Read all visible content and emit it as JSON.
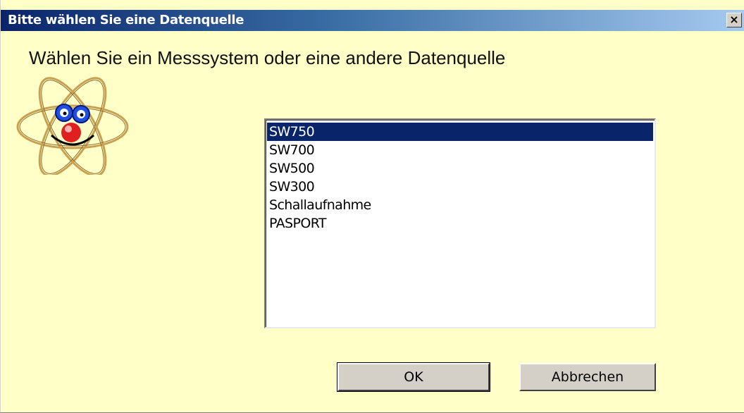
{
  "window": {
    "title": "Bitte wählen Sie eine Datenquelle",
    "close_label": "×"
  },
  "dialog": {
    "heading": "Wählen Sie ein Messsystem oder eine andere Datenquelle",
    "mascot_icon": "atom-mascot-icon",
    "list": {
      "items": [
        "SW750",
        "SW700",
        "SW500",
        "SW300",
        "Schallaufnahme",
        "PASPORT"
      ],
      "selected": "SW750"
    },
    "ok_label": "OK",
    "cancel_label": "Abbrechen"
  },
  "colors": {
    "background": "#ffffc8",
    "selection": "#0a246a",
    "title_gradient_start": "#0a246a",
    "title_gradient_end": "#a6caf0"
  }
}
